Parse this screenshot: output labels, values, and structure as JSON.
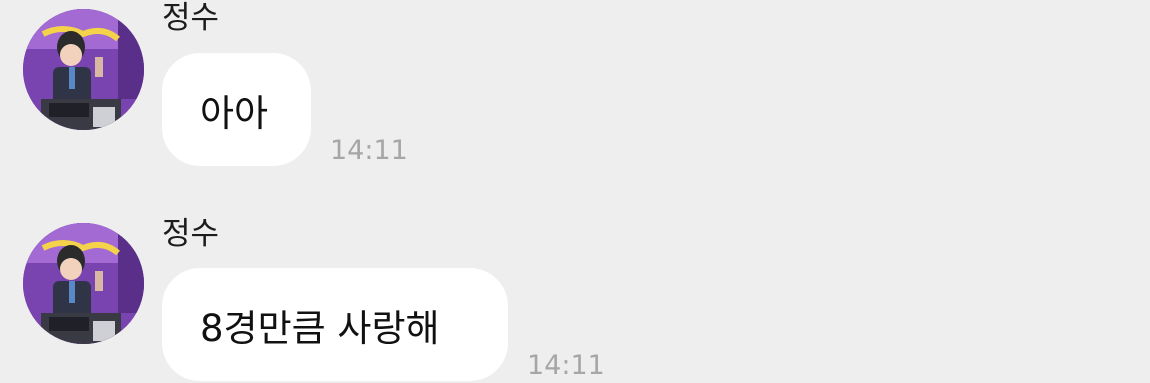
{
  "messages": [
    {
      "sender": "정수",
      "text": "아아",
      "time": "14:11"
    },
    {
      "sender": "정수",
      "text": "8경만큼 사랑해",
      "time": "14:11"
    }
  ],
  "colors": {
    "background": "#eeeeee",
    "bubble": "#ffffff",
    "timestamp": "#a6a6a6"
  }
}
